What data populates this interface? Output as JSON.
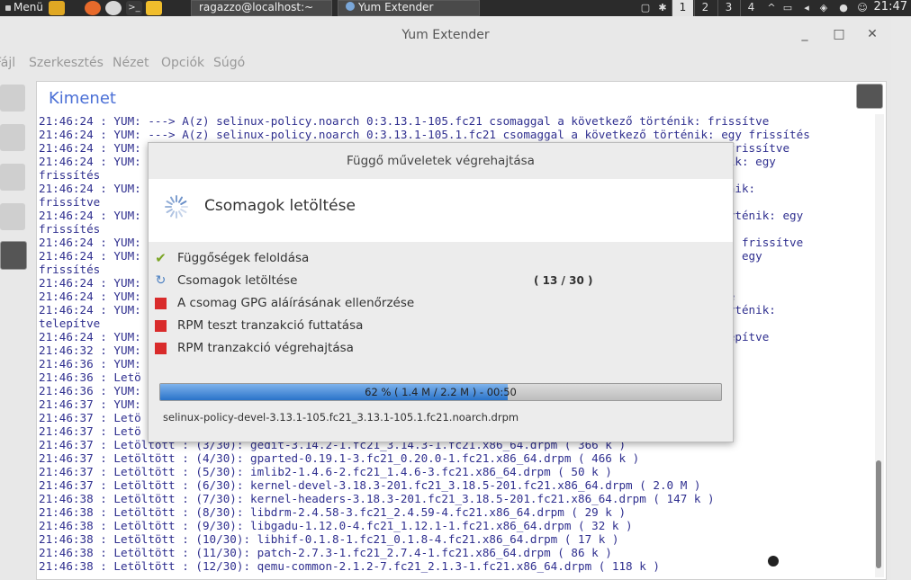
{
  "topbar": {
    "menu_label": "Menü",
    "tasks": [
      {
        "label": "ragazzo@localhost:~"
      },
      {
        "label": "Yum Extender"
      }
    ],
    "workspaces": [
      "1",
      "2",
      "3",
      "4"
    ],
    "clock": "21:47"
  },
  "window": {
    "title": "Yum Extender",
    "menus": [
      "Fájl",
      "Szerkesztés",
      "Nézet",
      "Opciók",
      "Súgó"
    ]
  },
  "output": {
    "heading": "Kimenet",
    "lines": [
      "21:46:24 : YUM: ---> A(z) selinux-policy.noarch 0:3.13.1-105.fc21 csomaggal a következő történik: frissítve",
      "21:46:24 : YUM: ---> A(z) selinux-policy.noarch 0:3.13.1-105.1.fc21 csomaggal a következő történik: egy frissítés",
      "21:46:24 : YUM:                                                                                 ték: frissítve",
      "21:46:24 : YUM:                                                                                 örténik: egy",
      "frissítés",
      "21:46:24 : YUM:                                                                                 történik:",
      "frissítve",
      "21:46:24 : YUM:                                                                                 ző történik: egy",
      "frissítés",
      "21:46:24 : YUM:                                                                                 ténik: frissítve",
      "21:46:24 : YUM:                                                                                 ténik: egy",
      "frissítés",
      "21:46:24 : YUM:",
      "21:46:24 : YUM:                                                                                 építve",
      "21:46:24 : YUM:                                                                                 ző történik:",
      "telepítve",
      "21:46:24 : YUM:                                                                                 : telepítve",
      "21:46:32 : YUM:",
      "21:46:36 : YUM:",
      "21:46:36 : Letö",
      "21:46:36 : YUM:",
      "21:46:37 : YUM:",
      "21:46:37 : Letö",
      "21:46:37 : Letö",
      "21:46:37 : Letöltött : (3/30): gedit-3.14.2-1.fc21_3.14.3-1.fc21.x86_64.drpm ( 366 k )",
      "21:46:37 : Letöltött : (4/30): gparted-0.19.1-3.fc21_0.20.0-1.fc21.x86_64.drpm ( 466 k )",
      "21:46:37 : Letöltött : (5/30): imlib2-1.4.6-2.fc21_1.4.6-3.fc21.x86_64.drpm ( 50 k )",
      "21:46:37 : Letöltött : (6/30): kernel-devel-3.18.3-201.fc21_3.18.5-201.fc21.x86_64.drpm ( 2.0 M )",
      "21:46:38 : Letöltött : (7/30): kernel-headers-3.18.3-201.fc21_3.18.5-201.fc21.x86_64.drpm ( 147 k )",
      "21:46:38 : Letöltött : (8/30): libdrm-2.4.58-3.fc21_2.4.59-4.fc21.x86_64.drpm ( 29 k )",
      "21:46:38 : Letöltött : (9/30): libgadu-1.12.0-4.fc21_1.12.1-1.fc21.x86_64.drpm ( 32 k )",
      "21:46:38 : Letöltött : (10/30): libhif-0.1.8-1.fc21_0.1.8-4.fc21.x86_64.drpm ( 17 k )",
      "21:46:38 : Letöltött : (11/30): patch-2.7.3-1.fc21_2.7.4-1.fc21.x86_64.drpm ( 86 k )",
      "21:46:38 : Letöltött : (12/30): qemu-common-2.1.2-7.fc21_2.1.3-1.fc21.x86_64.drpm ( 118 k )"
    ]
  },
  "dialog": {
    "title": "Függő műveletek végrehajtása",
    "stage": "Csomagok letöltése",
    "steps": [
      {
        "label": "Függőségek feloldása",
        "status": "done"
      },
      {
        "label": "Csomagok letöltése",
        "status": "active",
        "count": "( 13 / 30 )"
      },
      {
        "label": "A csomag GPG aláírásának ellenőrzése",
        "status": "pending"
      },
      {
        "label": "RPM teszt tranzakció futtatása",
        "status": "pending"
      },
      {
        "label": "RPM tranzakció végrehajtása",
        "status": "pending"
      }
    ],
    "progress_fraction": 0.62,
    "progress_text": "62 % ( 1.4 M / 2.2 M ) - 00:50",
    "package": "selinux-policy-devel-3.13.1-105.fc21_3.13.1-105.1.fc21.noarch.drpm"
  },
  "colors": {
    "heading": "#4a6fd6",
    "log_text": "#2f2f8f",
    "progress_fill": "#2a73c9",
    "pending_mark": "#d92b2b",
    "done_mark": "#7ba526"
  }
}
